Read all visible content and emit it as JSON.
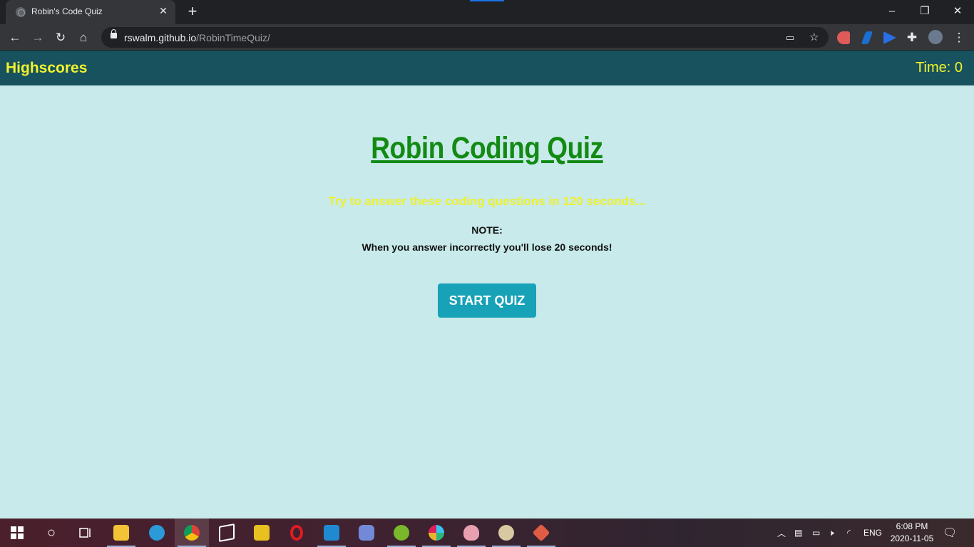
{
  "browser": {
    "tab_title": "Robin's Code Quiz",
    "tab_close": "✕",
    "new_tab": "+",
    "url_domain": "rswalm.github.io",
    "url_path": "/RobinTimeQuiz/",
    "window_minimize": "–",
    "window_restore": "❐",
    "window_close": "✕",
    "nav_back": "←",
    "nav_forward": "→",
    "nav_reload": "↻",
    "nav_home": "⌂",
    "bookmark": "☆",
    "extensions": "✚",
    "menu": "⋮"
  },
  "header": {
    "highscores_label": "Highscores",
    "timer_label": "Time: 0"
  },
  "quiz": {
    "title": "Robin Coding Quiz",
    "intro": "Try to answer these coding questions in 120 seconds...",
    "note_label": "NOTE:",
    "note_text": "When you answer incorrectly you'll lose 20 seconds!",
    "start_button": "START QUIZ"
  },
  "taskbar": {
    "search_icon": "○",
    "lang": "ENG",
    "time": "6:08 PM",
    "date": "2020-11-05"
  },
  "colors": {
    "page_bg": "#c8eaea",
    "header_bg": "#17525e",
    "header_text": "#f3f32c",
    "title_green": "#138a13",
    "intro_yellow": "#eef02a",
    "button_bg": "#17a2b8"
  }
}
